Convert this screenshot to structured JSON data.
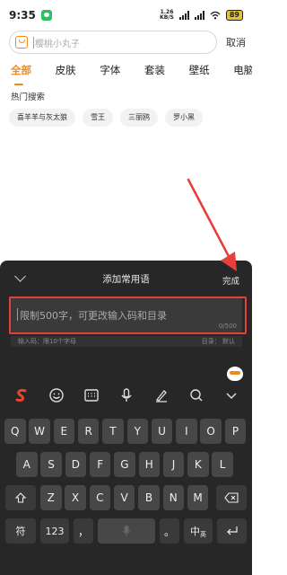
{
  "status_bar": {
    "time": "9:35",
    "speed_value": "1.26",
    "speed_unit": "KB/S",
    "battery": "89"
  },
  "search": {
    "placeholder": "樱桃小丸子",
    "cancel_label": "取消"
  },
  "tabs": [
    {
      "label": "全部",
      "active": true
    },
    {
      "label": "皮肤"
    },
    {
      "label": "字体"
    },
    {
      "label": "套装"
    },
    {
      "label": "壁纸"
    },
    {
      "label": "电脑端皮"
    }
  ],
  "hot_search": {
    "title": "热门搜索",
    "tags": [
      "喜羊羊与灰太狼",
      "雪王",
      "三丽鸥",
      "罗小黑"
    ]
  },
  "phrase_panel": {
    "title": "添加常用语",
    "done_label": "完成",
    "input_placeholder": "限制500字，可更改输入码和目录",
    "char_count": "0/500",
    "input_code_label": "输入码：限10个字母",
    "category_label": "目录：  默认"
  },
  "colors": {
    "accent": "#f08a1c",
    "annotation": "#e5403a",
    "panel_bg": "#272727",
    "key_bg": "#474747"
  },
  "toolbar_icons": [
    "sogou-logo-icon",
    "emoji-icon",
    "keyboard-icon",
    "microphone-icon",
    "handwriting-icon",
    "search-icon",
    "collapse-keyboard-icon"
  ],
  "keyboard": {
    "row1": [
      "Q",
      "W",
      "E",
      "R",
      "T",
      "Y",
      "U",
      "I",
      "O",
      "P"
    ],
    "row2": [
      "A",
      "S",
      "D",
      "F",
      "G",
      "H",
      "J",
      "K",
      "L"
    ],
    "row3": [
      "Z",
      "X",
      "C",
      "V",
      "B",
      "N",
      "M"
    ],
    "symbol_key": "符",
    "number_key": "123",
    "comma_key": "，",
    "period_key": "。",
    "lang_key": "中",
    "lang_sub": "英"
  }
}
